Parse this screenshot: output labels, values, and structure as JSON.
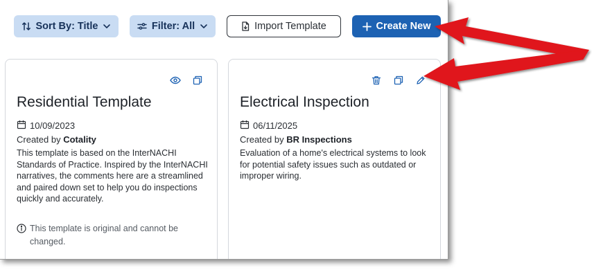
{
  "toolbar": {
    "sort_label": "Sort By: Title",
    "filter_label": "Filter: All",
    "import_label": "Import Template",
    "create_label": "Create New"
  },
  "colors": {
    "primary": "#1d62b3",
    "soft_button": "#c9dcf3",
    "annotation_arrow": "#e0141a",
    "icon_blue": "#1d62b3"
  },
  "cards": [
    {
      "title": "Residential Template",
      "date": "10/09/2023",
      "created_prefix": "Created by ",
      "creator": "Cotality",
      "description": "This template is based on the InterNACHI Standards of Practice. Inspired by the InterNACHI narratives, the comments here are a streamlined and paired down set to help you do inspections quickly and accurately.",
      "note": "This template is original and cannot be changed.",
      "icons": [
        "eye-icon",
        "copy-icon"
      ]
    },
    {
      "title": "Electrical Inspection",
      "date": "06/11/2025",
      "created_prefix": "Created by ",
      "creator": "BR Inspections",
      "description": "Evaluation of a home's electrical systems to look for potential safety issues such as outdated or improper wiring.",
      "icons": [
        "trash-icon",
        "copy-icon",
        "pencil-icon"
      ]
    }
  ]
}
